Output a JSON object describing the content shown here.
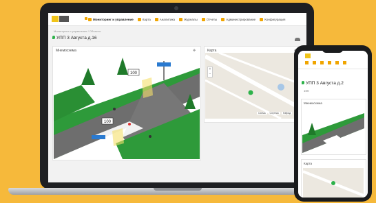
{
  "laptop": {
    "menu": [
      {
        "label": "Мониторинг и управление",
        "active": true
      },
      {
        "label": "Карта"
      },
      {
        "label": "Аналитика"
      },
      {
        "label": "Журналы"
      },
      {
        "label": "Отчеты"
      },
      {
        "label": "Администрирование"
      },
      {
        "label": "Конфигурация"
      }
    ],
    "breadcrumb": "Мониторинг и управление / Объекты",
    "page_title": "УПП 3 Августа д.16",
    "scene_card_title": "Мнемосхема",
    "map_card_title": "Карта",
    "speed_sign_1": "100",
    "speed_sign_2": "100",
    "map_tabs": [
      "Схема",
      "Спутник",
      "Гибрид"
    ]
  },
  "phone": {
    "title": "УПП 3 Августа д.2",
    "subtitle": "100",
    "scene_card_title": "Мнемосхема",
    "map_card_title": "Карта"
  },
  "colors": {
    "background": "#f6b93b",
    "accent": "#f0a500",
    "status_green": "#2db24a"
  }
}
